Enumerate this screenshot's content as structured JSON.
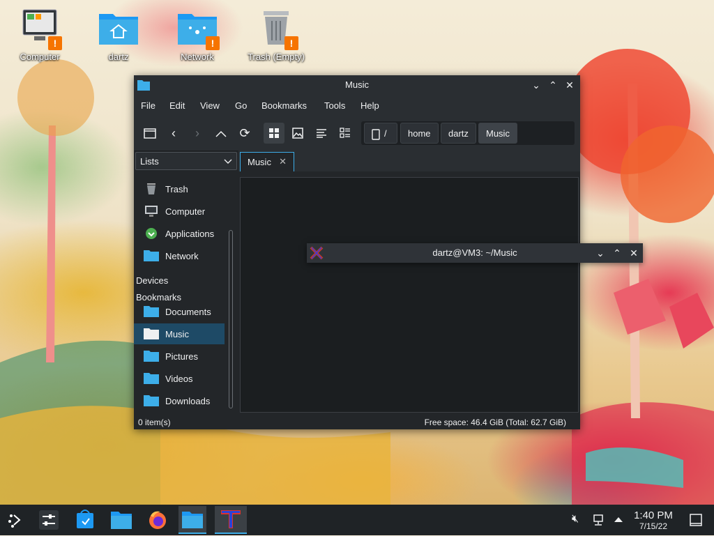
{
  "desktop": {
    "icons": [
      {
        "label": "Computer"
      },
      {
        "label": "dartz"
      },
      {
        "label": "Network"
      },
      {
        "label": "Trash (Empty)"
      }
    ],
    "badge": "!"
  },
  "dolphin": {
    "title": "Music",
    "menu": [
      "File",
      "Edit",
      "View",
      "Go",
      "Bookmarks",
      "Tools",
      "Help"
    ],
    "breadcrumb": [
      "/",
      "home",
      "dartz",
      "Music"
    ],
    "places_panel_label": "Lists",
    "tab_label": "Music",
    "places": [
      {
        "label": "Trash"
      },
      {
        "label": "Computer"
      },
      {
        "label": "Applications"
      },
      {
        "label": "Network"
      }
    ],
    "devices_heading": "Devices",
    "bookmarks_heading": "Bookmarks",
    "bookmarks": [
      {
        "label": "Documents"
      },
      {
        "label": "Music"
      },
      {
        "label": "Pictures"
      },
      {
        "label": "Videos"
      },
      {
        "label": "Downloads"
      }
    ],
    "status_items": "0 item(s)",
    "status_space": "Free space: 46.4 GiB (Total: 62.7 GiB)"
  },
  "terminal": {
    "title": "dartz@VM3: ~/Music"
  },
  "taskbar": {
    "time": "1:40 PM",
    "date": "7/15/22"
  },
  "colors": {
    "accent": "#3daee9",
    "folder": "#3daee9",
    "badge": "#f67400"
  }
}
